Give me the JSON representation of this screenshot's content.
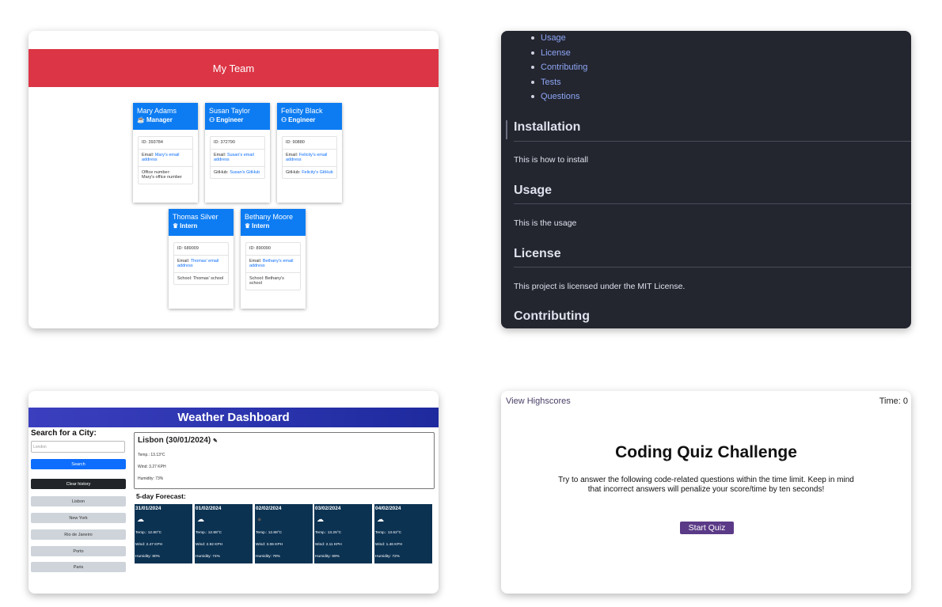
{
  "team": {
    "title": "My Team",
    "cards": [
      {
        "name": "Mary Adams",
        "role": "Manager",
        "role_icon": "coffee-icon",
        "icon_glyph": "☕",
        "id": "ID: 393784",
        "email_label": "Email:",
        "email": "Mary's email address",
        "extra_label": "Office number:",
        "extra": "Mary's office number"
      },
      {
        "name": "Susan Taylor",
        "role": "Engineer",
        "role_icon": "glasses-icon",
        "icon_glyph": "⚇",
        "id": "ID: 372790",
        "email_label": "Email:",
        "email": "Susan's email address",
        "extra_label": "GitHub:",
        "extra": "Susan's GitHub"
      },
      {
        "name": "Felicity Black",
        "role": "Engineer",
        "role_icon": "glasses-icon",
        "icon_glyph": "⚇",
        "id": "ID: 90880",
        "email_label": "Email:",
        "email": "Felicity's email address",
        "extra_label": "GitHub:",
        "extra": "Felicity's GitHub"
      },
      {
        "name": "Thomas Silver",
        "role": "Intern",
        "role_icon": "graduate-icon",
        "icon_glyph": "♛",
        "id": "ID: 689009",
        "email_label": "Email:",
        "email": "Thomas' email address",
        "extra_label": "School:",
        "extra": "Thomas' school"
      },
      {
        "name": "Bethany Moore",
        "role": "Intern",
        "role_icon": "graduate-icon",
        "icon_glyph": "♛",
        "id": "ID: 890090",
        "email_label": "Email:",
        "email": "Bethany's email address",
        "extra_label": "School:",
        "extra": "Bethany's school"
      }
    ]
  },
  "readme": {
    "toc": [
      "Usage",
      "License",
      "Contributing",
      "Tests",
      "Questions"
    ],
    "sections": [
      {
        "heading": "Installation",
        "text": "This is how to install"
      },
      {
        "heading": "Usage",
        "text": "This is the usage"
      },
      {
        "heading": "License",
        "text": "This project is licensed under the MIT License."
      },
      {
        "heading": "Contributing",
        "text": ""
      }
    ]
  },
  "weather": {
    "title": "Weather Dashboard",
    "search_label": "Search for a City:",
    "search_placeholder": "London",
    "search_button": "Search",
    "clear_button": "Clear history",
    "history": [
      "Lisbon",
      "New York",
      "Rio de Janeiro",
      "Porto",
      "Paris"
    ],
    "current": {
      "title": "Lisbon (30/01/2024)",
      "temp": "Temp.: 13.13°C",
      "wind": "Wind: 3.27 KPH",
      "humidity": "Humidity: 73%"
    },
    "forecast_label": "5-day Forecast:",
    "forecast": [
      {
        "date": "31/01/2024",
        "icon": "cloud-icon",
        "temp": "Temp.: 12.80°C",
        "wind": "Wind: 2.47 KPH",
        "humidity": "Humidity: 80%"
      },
      {
        "date": "01/02/2024",
        "icon": "cloud-icon",
        "temp": "Temp.: 12.88°C",
        "wind": "Wind: 2.92 KPH",
        "humidity": "Humidity: 74%"
      },
      {
        "date": "02/02/2024",
        "icon": "moon-icon",
        "temp": "Temp.: 12.88°C",
        "wind": "Wind: 3.06 KPH",
        "humidity": "Humidity: 78%"
      },
      {
        "date": "03/02/2024",
        "icon": "cloud-icon",
        "temp": "Temp.: 13.25°C",
        "wind": "Wind: 2.11 KPH",
        "humidity": "Humidity: 69%"
      },
      {
        "date": "04/02/2024",
        "icon": "cloud-icon",
        "temp": "Temp.: 13.62°C",
        "wind": "Wind: 1.46 KPH",
        "humidity": "Humidity: 72%"
      }
    ],
    "colors": {
      "header": "#2b32b2",
      "search_btn": "#0d6efd",
      "clear_btn": "#212529",
      "history_btn": "#ced4da",
      "forecast_bg": "#0c3252"
    }
  },
  "quiz": {
    "highscores": "View Highscores",
    "time": "Time: 0",
    "title": "Coding Quiz Challenge",
    "description": "Try to answer the following code-related questions within the time limit. Keep in mind that incorrect answers will penalize your score/time by ten seconds!",
    "start": "Start Quiz",
    "accent": "#5b3a87"
  }
}
